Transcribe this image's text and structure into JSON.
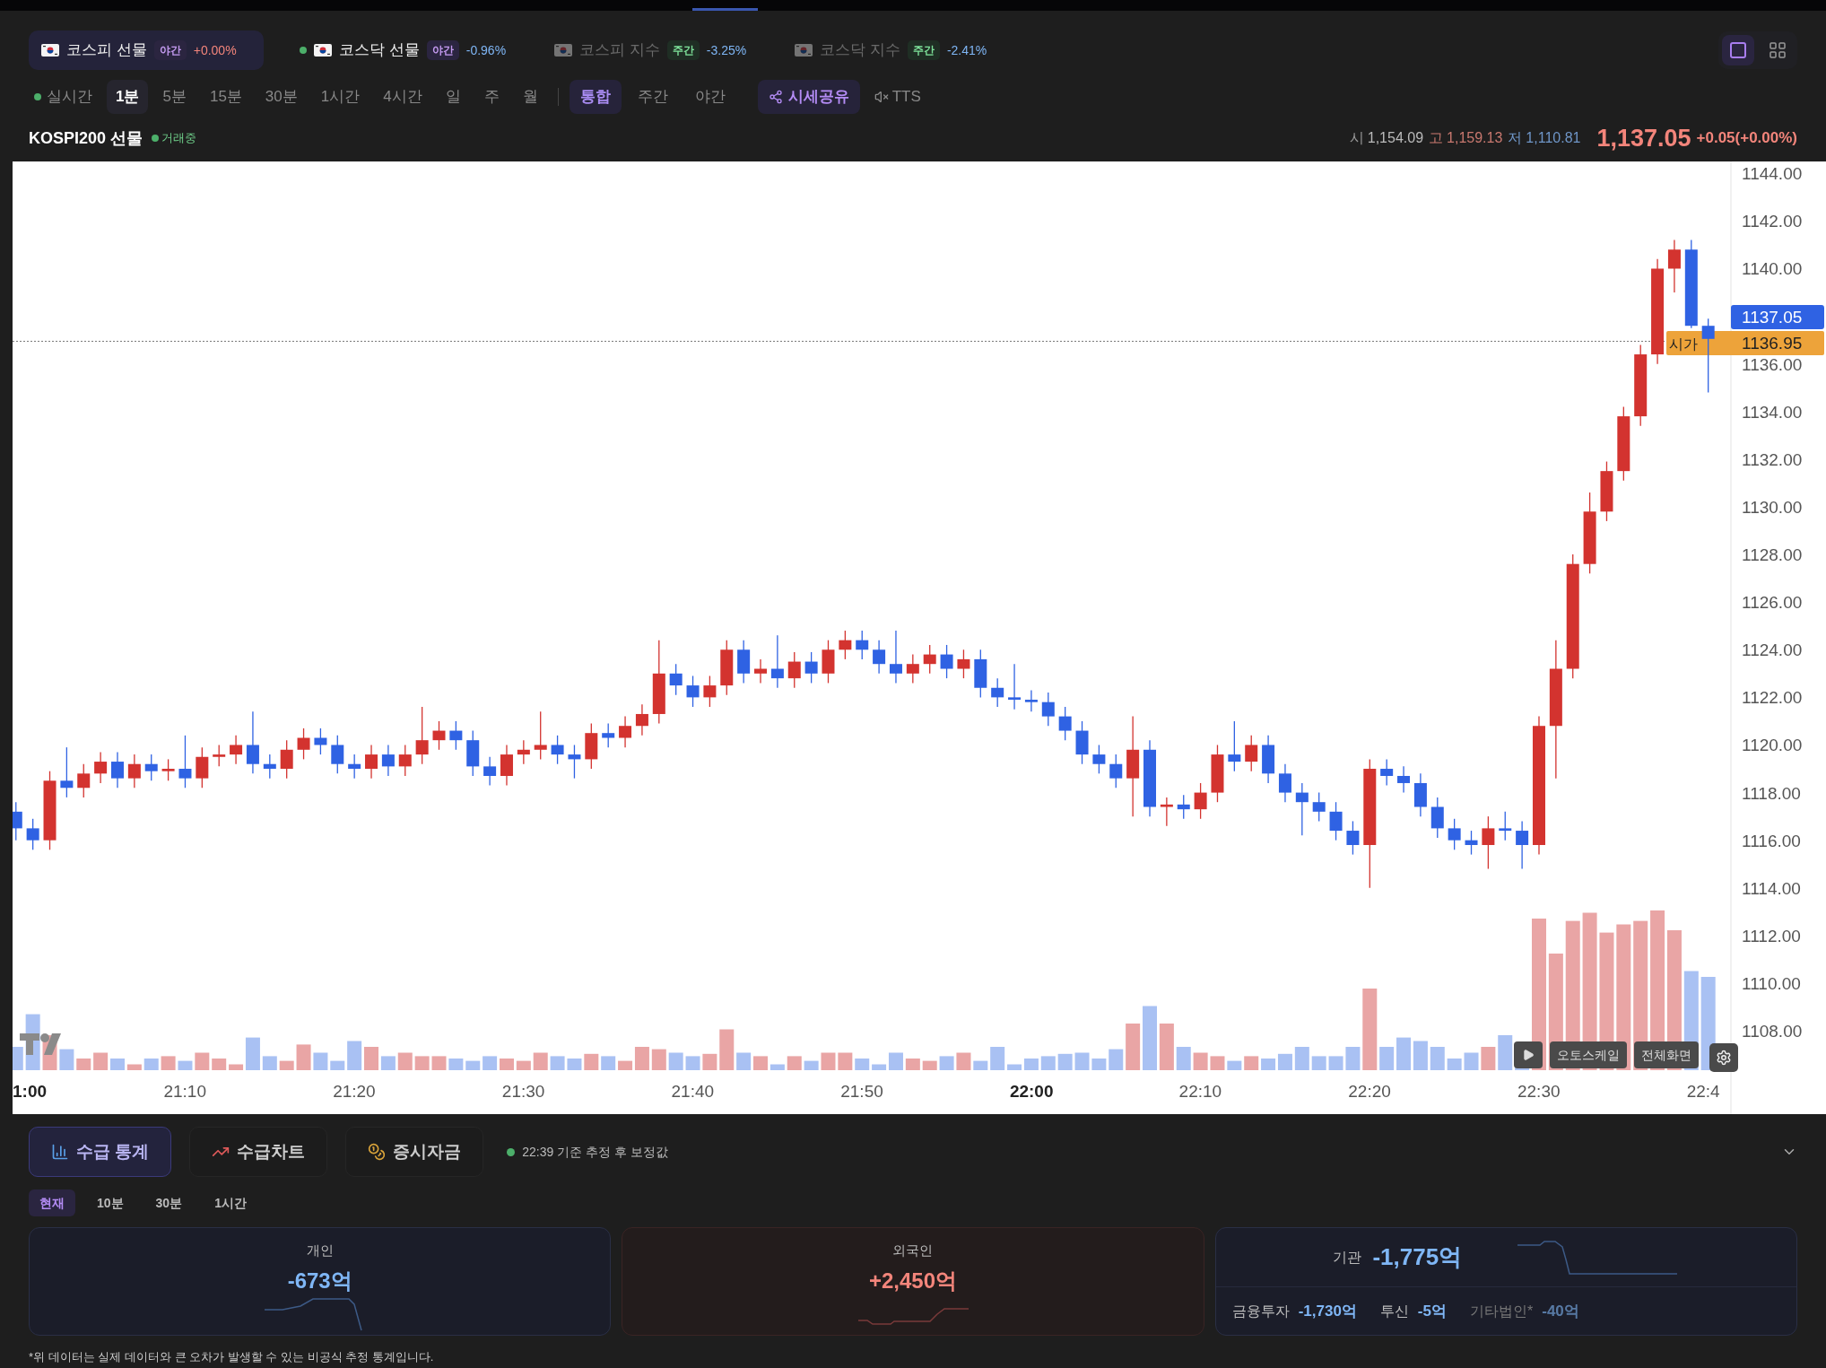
{
  "top_tickers": [
    {
      "name": "코스피 선물",
      "session": {
        "text": "야간",
        "kind": "night"
      },
      "change": "+0.00%",
      "color": "#f3857b",
      "selected": true,
      "live": false,
      "dimmed": false
    },
    {
      "name": "코스닥 선물",
      "session": {
        "text": "야간",
        "kind": "night"
      },
      "change": "-0.96%",
      "color": "#7fb6f5",
      "selected": false,
      "live": true,
      "dimmed": false
    },
    {
      "name": "코스피 지수",
      "session": {
        "text": "주간",
        "kind": "day"
      },
      "change": "-3.25%",
      "color": "#7fb6f5",
      "selected": false,
      "live": false,
      "dimmed": true
    },
    {
      "name": "코스닥 지수",
      "session": {
        "text": "주간",
        "kind": "day"
      },
      "change": "-2.41%",
      "color": "#7fb6f5",
      "selected": false,
      "live": false,
      "dimmed": true
    }
  ],
  "layout_toggle": [
    {
      "kind": "single",
      "selected": true
    },
    {
      "kind": "grid",
      "selected": false
    }
  ],
  "toolbar": {
    "realtime": "실시간",
    "intervals": [
      {
        "label": "1분",
        "selected": true
      },
      {
        "label": "5분",
        "selected": false
      },
      {
        "label": "15분",
        "selected": false
      },
      {
        "label": "30분",
        "selected": false
      },
      {
        "label": "1시간",
        "selected": false
      },
      {
        "label": "4시간",
        "selected": false
      },
      {
        "label": "일",
        "selected": false
      },
      {
        "label": "주",
        "selected": false
      },
      {
        "label": "월",
        "selected": false
      }
    ],
    "sessions": [
      {
        "label": "통합",
        "selected": true
      },
      {
        "label": "주간",
        "selected": false
      },
      {
        "label": "야간",
        "selected": false
      }
    ],
    "share": "시세공유",
    "tts": "TTS"
  },
  "instrument": {
    "name": "KOSPI200 선물",
    "status": "거래중",
    "open_label": "시",
    "open": "1,154.09",
    "high_label": "고",
    "high": "1,159.13",
    "low_label": "저",
    "low": "1,110.81",
    "price": "1,137.05",
    "change": "+0.05(+0.00%)"
  },
  "chart": {
    "chart_data": {
      "type": "candlestick",
      "categories": [
        "1:00",
        null,
        null,
        null,
        null,
        null,
        null,
        null,
        null,
        null,
        "21:10",
        null,
        null,
        null,
        null,
        null,
        null,
        null,
        null,
        null,
        "21:20",
        null,
        null,
        null,
        null,
        null,
        null,
        null,
        null,
        null,
        "21:30",
        null,
        null,
        null,
        null,
        null,
        null,
        null,
        null,
        null,
        "21:40",
        null,
        null,
        null,
        null,
        null,
        null,
        null,
        null,
        null,
        "21:50",
        null,
        null,
        null,
        null,
        null,
        null,
        null,
        null,
        null,
        "22:00",
        null,
        null,
        null,
        null,
        null,
        null,
        null,
        null,
        null,
        "22:10",
        null,
        null,
        null,
        null,
        null,
        null,
        null,
        null,
        null,
        "22:20",
        null,
        null,
        null,
        null,
        null,
        null,
        null,
        null,
        null,
        "22:30",
        null,
        null,
        null,
        null,
        null,
        null,
        null,
        null,
        null,
        "22:4"
      ],
      "ohlc": [
        [
          1117.2,
          1117.6,
          1116.0,
          1116.5
        ],
        [
          1116.5,
          1116.9,
          1115.6,
          1116.0
        ],
        [
          1116.0,
          1118.9,
          1115.6,
          1118.5
        ],
        [
          1118.5,
          1119.9,
          1117.8,
          1118.2
        ],
        [
          1118.2,
          1119.2,
          1117.8,
          1118.8
        ],
        [
          1118.8,
          1119.7,
          1118.4,
          1119.3
        ],
        [
          1119.3,
          1119.7,
          1118.2,
          1118.6
        ],
        [
          1118.6,
          1119.6,
          1118.2,
          1119.2
        ],
        [
          1119.2,
          1119.6,
          1118.5,
          1118.9
        ],
        [
          1118.9,
          1119.4,
          1118.5,
          1119.0
        ],
        [
          1119.0,
          1120.4,
          1118.2,
          1118.6
        ],
        [
          1118.6,
          1119.9,
          1118.2,
          1119.5
        ],
        [
          1119.5,
          1120.0,
          1119.1,
          1119.6
        ],
        [
          1119.6,
          1120.4,
          1119.2,
          1120.0
        ],
        [
          1120.0,
          1121.4,
          1118.8,
          1119.2
        ],
        [
          1119.2,
          1119.6,
          1118.6,
          1119.0
        ],
        [
          1119.0,
          1120.2,
          1118.6,
          1119.8
        ],
        [
          1119.8,
          1120.7,
          1119.4,
          1120.3
        ],
        [
          1120.3,
          1120.7,
          1119.6,
          1120.0
        ],
        [
          1120.0,
          1120.4,
          1118.8,
          1119.2
        ],
        [
          1119.2,
          1119.6,
          1118.6,
          1119.0
        ],
        [
          1119.0,
          1120.0,
          1118.6,
          1119.6
        ],
        [
          1119.6,
          1120.0,
          1118.7,
          1119.1
        ],
        [
          1119.1,
          1120.0,
          1118.7,
          1119.6
        ],
        [
          1119.6,
          1121.6,
          1119.2,
          1120.2
        ],
        [
          1120.2,
          1121.0,
          1119.8,
          1120.6
        ],
        [
          1120.6,
          1121.0,
          1119.8,
          1120.2
        ],
        [
          1120.2,
          1120.6,
          1118.7,
          1119.1
        ],
        [
          1119.1,
          1119.5,
          1118.3,
          1118.7
        ],
        [
          1118.7,
          1120.0,
          1118.3,
          1119.6
        ],
        [
          1119.6,
          1120.2,
          1119.2,
          1119.8
        ],
        [
          1119.8,
          1121.4,
          1119.4,
          1120.0
        ],
        [
          1120.0,
          1120.4,
          1119.2,
          1119.6
        ],
        [
          1119.6,
          1120.0,
          1118.6,
          1119.4
        ],
        [
          1119.4,
          1120.9,
          1119.0,
          1120.5
        ],
        [
          1120.5,
          1120.9,
          1119.9,
          1120.3
        ],
        [
          1120.3,
          1121.2,
          1119.9,
          1120.8
        ],
        [
          1120.8,
          1121.7,
          1120.4,
          1121.3
        ],
        [
          1121.3,
          1124.4,
          1120.9,
          1123.0
        ],
        [
          1123.0,
          1123.4,
          1122.1,
          1122.5
        ],
        [
          1122.5,
          1122.9,
          1121.6,
          1122.0
        ],
        [
          1122.0,
          1122.9,
          1121.6,
          1122.5
        ],
        [
          1122.5,
          1124.4,
          1122.1,
          1124.0
        ],
        [
          1124.0,
          1124.4,
          1122.6,
          1123.0
        ],
        [
          1123.0,
          1123.6,
          1122.6,
          1123.2
        ],
        [
          1123.2,
          1124.6,
          1122.4,
          1122.8
        ],
        [
          1122.8,
          1123.9,
          1122.4,
          1123.5
        ],
        [
          1123.5,
          1123.9,
          1122.6,
          1123.0
        ],
        [
          1123.0,
          1124.4,
          1122.6,
          1124.0
        ],
        [
          1124.0,
          1124.8,
          1123.6,
          1124.4
        ],
        [
          1124.4,
          1124.8,
          1123.6,
          1124.0
        ],
        [
          1124.0,
          1124.4,
          1123.0,
          1123.4
        ],
        [
          1123.4,
          1124.8,
          1122.6,
          1123.0
        ],
        [
          1123.0,
          1123.8,
          1122.6,
          1123.4
        ],
        [
          1123.4,
          1124.2,
          1123.0,
          1123.8
        ],
        [
          1123.8,
          1124.2,
          1122.8,
          1123.2
        ],
        [
          1123.2,
          1124.0,
          1122.8,
          1123.6
        ],
        [
          1123.6,
          1124.0,
          1122.0,
          1122.4
        ],
        [
          1122.4,
          1122.8,
          1121.6,
          1122.0
        ],
        [
          1122.0,
          1123.4,
          1121.5,
          1121.9
        ],
        [
          1121.9,
          1122.3,
          1121.4,
          1121.8
        ],
        [
          1121.8,
          1122.2,
          1120.8,
          1121.2
        ],
        [
          1121.2,
          1121.6,
          1120.2,
          1120.6
        ],
        [
          1120.6,
          1121.0,
          1119.2,
          1119.6
        ],
        [
          1119.6,
          1120.0,
          1118.8,
          1119.2
        ],
        [
          1119.2,
          1119.6,
          1118.2,
          1118.6
        ],
        [
          1118.6,
          1121.2,
          1117.0,
          1119.8
        ],
        [
          1119.8,
          1120.2,
          1117.0,
          1117.4
        ],
        [
          1117.4,
          1117.8,
          1116.6,
          1117.5
        ],
        [
          1117.5,
          1117.9,
          1116.9,
          1117.3
        ],
        [
          1117.3,
          1118.4,
          1116.9,
          1118.0
        ],
        [
          1118.0,
          1120.0,
          1117.6,
          1119.6
        ],
        [
          1119.6,
          1121.0,
          1118.9,
          1119.3
        ],
        [
          1119.3,
          1120.4,
          1118.9,
          1120.0
        ],
        [
          1120.0,
          1120.4,
          1118.4,
          1118.8
        ],
        [
          1118.8,
          1119.2,
          1117.6,
          1118.0
        ],
        [
          1118.0,
          1118.4,
          1116.2,
          1117.6
        ],
        [
          1117.6,
          1118.0,
          1116.8,
          1117.2
        ],
        [
          1117.2,
          1117.6,
          1116.0,
          1116.4
        ],
        [
          1116.4,
          1116.8,
          1115.4,
          1115.8
        ],
        [
          1115.8,
          1119.4,
          1114.0,
          1119.0
        ],
        [
          1119.0,
          1119.4,
          1118.3,
          1118.7
        ],
        [
          1118.7,
          1119.1,
          1118.0,
          1118.4
        ],
        [
          1118.4,
          1118.8,
          1117.0,
          1117.4
        ],
        [
          1117.4,
          1117.8,
          1116.1,
          1116.5
        ],
        [
          1116.5,
          1116.9,
          1115.6,
          1116.0
        ],
        [
          1116.0,
          1116.4,
          1115.4,
          1115.8
        ],
        [
          1115.8,
          1117.0,
          1114.8,
          1116.5
        ],
        [
          1116.5,
          1117.2,
          1116.0,
          1116.4
        ],
        [
          1116.4,
          1116.8,
          1114.8,
          1115.8
        ],
        [
          1115.8,
          1121.2,
          1115.4,
          1120.8
        ],
        [
          1120.8,
          1124.4,
          1118.6,
          1123.2
        ],
        [
          1123.2,
          1128.0,
          1122.8,
          1127.6
        ],
        [
          1127.6,
          1130.6,
          1127.2,
          1129.8
        ],
        [
          1129.8,
          1131.9,
          1129.4,
          1131.5
        ],
        [
          1131.5,
          1134.2,
          1131.1,
          1133.8
        ],
        [
          1133.8,
          1136.8,
          1133.4,
          1136.4
        ],
        [
          1136.4,
          1140.4,
          1136.0,
          1140.0
        ],
        [
          1140.0,
          1141.2,
          1139.0,
          1140.8
        ],
        [
          1140.8,
          1141.2,
          1137.5,
          1137.6
        ],
        [
          1137.6,
          1137.9,
          1134.8,
          1137.05
        ]
      ],
      "ylim": [
        1104.5,
        1144.5
      ],
      "yticks": [
        {
          "value": 1144,
          "label": "1144.00"
        },
        {
          "value": 1142,
          "label": "1142.00"
        },
        {
          "value": 1140,
          "label": "1140.00"
        },
        {
          "value": 1136,
          "label": "1136.00"
        },
        {
          "value": 1134,
          "label": "1134.00"
        },
        {
          "value": 1132,
          "label": "1132.00"
        },
        {
          "value": 1130,
          "label": "1130.00"
        },
        {
          "value": 1128,
          "label": "1128.00"
        },
        {
          "value": 1126,
          "label": "1126.00"
        },
        {
          "value": 1124,
          "label": "1124.00"
        },
        {
          "value": 1122,
          "label": "1122.00"
        },
        {
          "value": 1120,
          "label": "1120.00"
        },
        {
          "value": 1118,
          "label": "1118.00"
        },
        {
          "value": 1116,
          "label": "1116.00"
        },
        {
          "value": 1114,
          "label": "1114.00"
        },
        {
          "value": 1112,
          "label": "1112.00"
        },
        {
          "value": 1110,
          "label": "1110.00"
        },
        {
          "value": 1108,
          "label": "1108.00"
        }
      ],
      "ref_lines": [
        {
          "axis": "y",
          "value": 1136.95
        }
      ]
    },
    "bold_xticks": [
      true,
      false,
      false,
      false,
      false,
      false,
      true,
      false,
      false,
      false,
      false
    ],
    "last_price_tag": "1137.05",
    "open_tag_label": "시가",
    "open_tag": "1136.95",
    "controls": [
      "오토스케일",
      "전체화면"
    ]
  },
  "flow_tabs": [
    {
      "label": "수급 통계",
      "selected": true
    },
    {
      "label": "수급차트",
      "selected": false
    },
    {
      "label": "증시자금",
      "selected": false
    }
  ],
  "update_note": "22:39 기준 추정 후 보정값",
  "periods": [
    {
      "label": "현재",
      "selected": true
    },
    {
      "label": "10분",
      "selected": false
    },
    {
      "label": "30분",
      "selected": false
    },
    {
      "label": "1시간",
      "selected": false
    }
  ],
  "cards": [
    {
      "kind": "simple",
      "title": "개인",
      "value": "-673억",
      "color": "#7fb6f5"
    },
    {
      "kind": "simple",
      "title": "외국인",
      "value": "+2,450억",
      "color": "#f3857b"
    },
    {
      "kind": "detailed",
      "title": "기관",
      "value": "-1,775억",
      "color": "#7fb6f5",
      "breakdown": [
        {
          "label": "금융투자",
          "value": "-1,730억",
          "dimmed": false
        },
        {
          "label": "투신",
          "value": "-5억",
          "dimmed": false
        },
        {
          "label": "기타법인*",
          "value": "-40억",
          "dimmed": true
        }
      ]
    }
  ],
  "footnote": "*위 데이터는 실제 데이터와 큰 오차가 발생할 수 있는 비공식 추정 통계입니다."
}
